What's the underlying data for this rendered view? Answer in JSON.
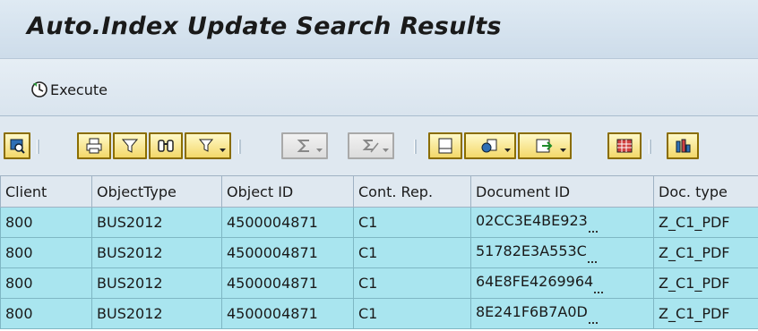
{
  "title": "Auto.Index Update Search Results",
  "app_toolbar": {
    "execute_label": "Execute"
  },
  "alv_toolbar": {
    "buttons": [
      {
        "icon": "details-icon"
      },
      {
        "icon": "print-icon"
      },
      {
        "icon": "filter-icon"
      },
      {
        "icon": "find-icon"
      },
      {
        "icon": "set-filter-icon"
      },
      {
        "icon": "sum-icon"
      },
      {
        "icon": "subtotal-icon"
      },
      {
        "icon": "print-preview-icon"
      },
      {
        "icon": "views-icon"
      },
      {
        "icon": "export-icon"
      },
      {
        "icon": "select-layout-icon"
      },
      {
        "icon": "report-icon"
      }
    ]
  },
  "table": {
    "columns": [
      "Client",
      "ObjectType",
      "Object ID",
      "Cont. Rep.",
      "Document ID",
      "Doc. type"
    ],
    "rows": [
      [
        "800",
        "BUS2012",
        "4500004871",
        "C1",
        "02CC3E4BE923",
        "Z_C1_PDF"
      ],
      [
        "800",
        "BUS2012",
        "4500004871",
        "C1",
        "51782E3A553C",
        "Z_C1_PDF"
      ],
      [
        "800",
        "BUS2012",
        "4500004871",
        "C1",
        "64E8FE4269964",
        "Z_C1_PDF"
      ],
      [
        "800",
        "BUS2012",
        "4500004871",
        "C1",
        "8E241F6B7A0D",
        "Z_C1_PDF"
      ]
    ]
  },
  "colors": {
    "row_bg": "#a9e5ef",
    "header_bg": "#dfe8f0",
    "title_bg": "#cddcea"
  }
}
